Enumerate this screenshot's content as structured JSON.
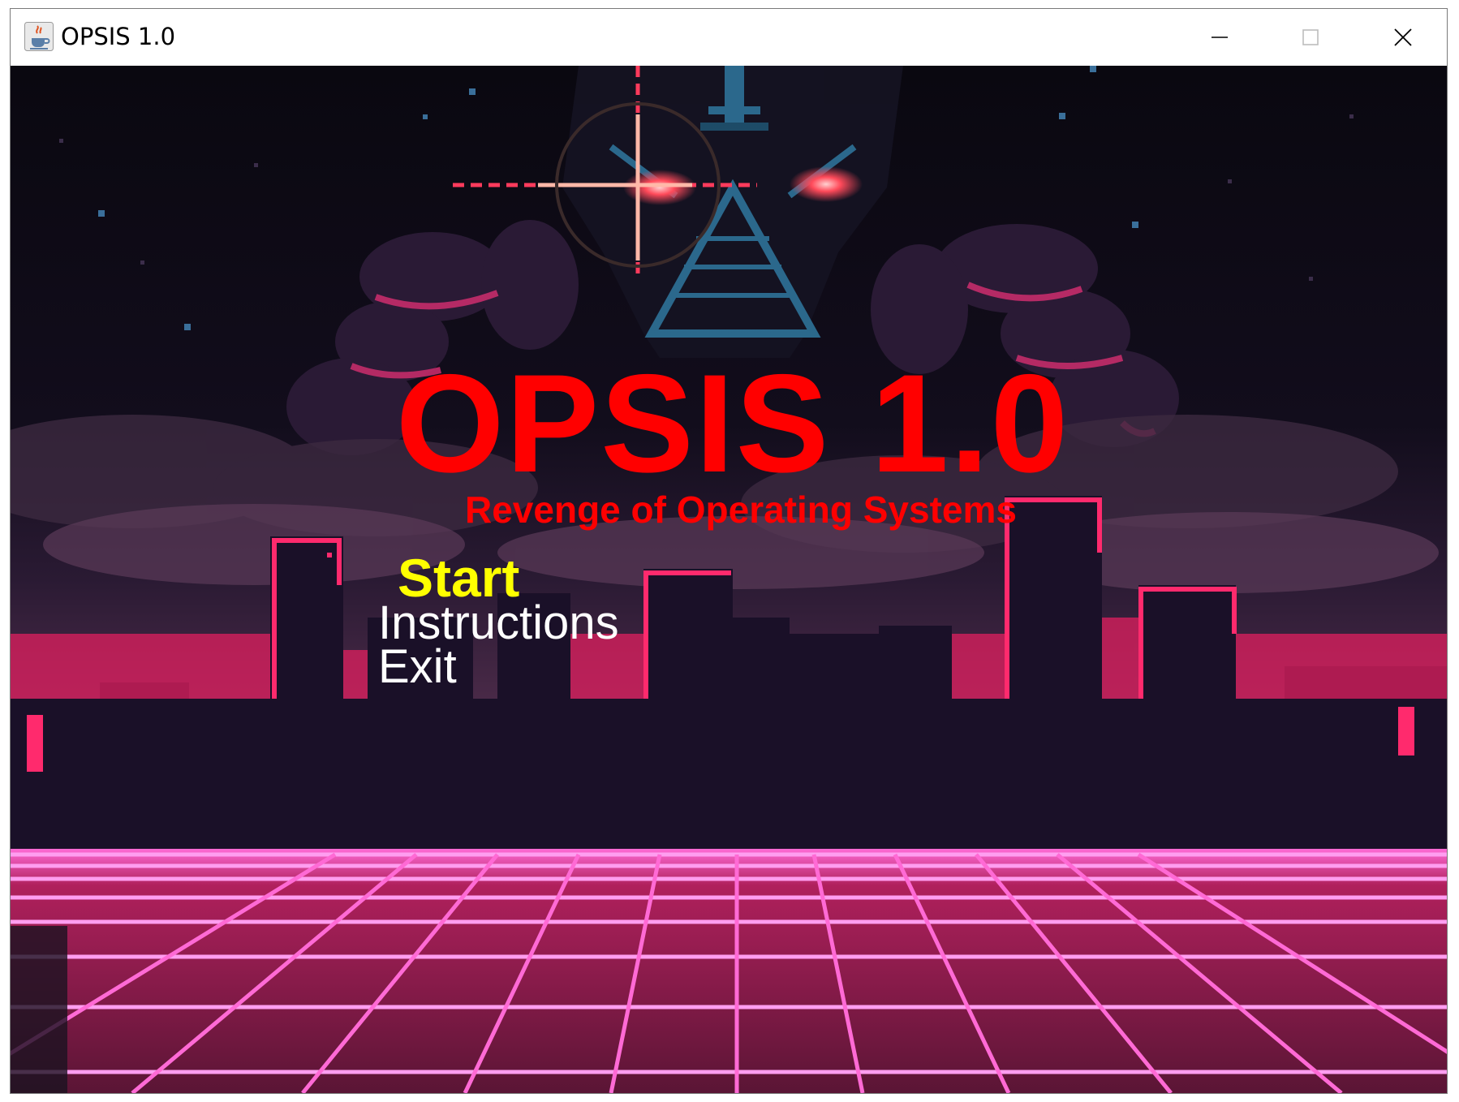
{
  "window": {
    "title": "OPSIS 1.0",
    "icon": "java-cup-icon",
    "controls": [
      "minimize-icon",
      "maximize-icon",
      "close-icon"
    ]
  },
  "game": {
    "title": "OPSIS 1.0",
    "subtitle": "Revenge of Operating Systems",
    "menu": {
      "start": "Start",
      "instructions": "Instructions",
      "exit": "Exit",
      "selected": "Start"
    },
    "colors": {
      "title": "#ff0000",
      "selected_item": "#ffff00",
      "menu_item": "#ffffff",
      "sky": "#0c0a12",
      "neon_pink": "#ff2a6d",
      "grid": "#ff6ad5"
    }
  }
}
